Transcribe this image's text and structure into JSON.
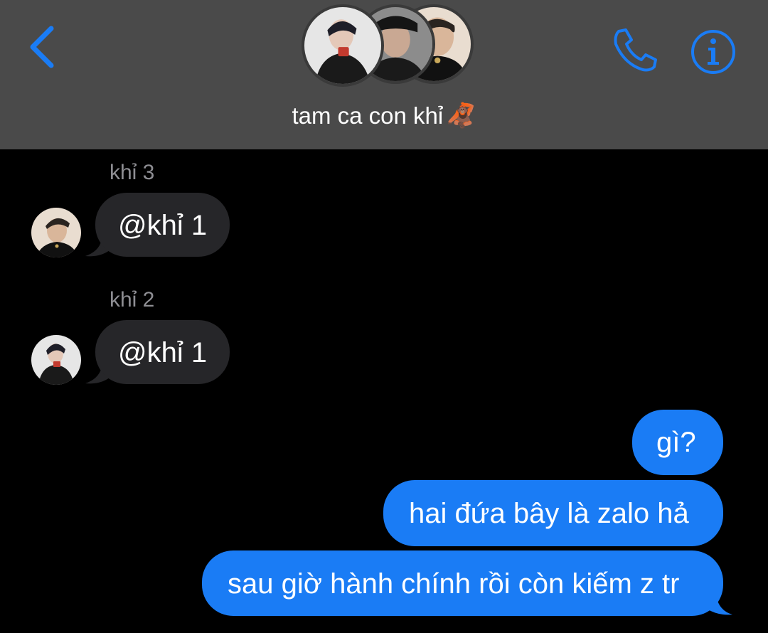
{
  "header": {
    "group_name": "tam ca con khỉ",
    "group_emoji": "🦧",
    "back_icon": "chevron-left-icon",
    "call_icon": "phone-icon",
    "info_icon": "info-icon",
    "accent_color": "#1a7cf5"
  },
  "messages": [
    {
      "direction": "incoming",
      "sender": "khỉ 3",
      "text": "@khỉ 1"
    },
    {
      "direction": "incoming",
      "sender": "khỉ 2",
      "text": "@khỉ 1"
    },
    {
      "direction": "outgoing",
      "text": "gì?"
    },
    {
      "direction": "outgoing",
      "text": "hai đứa bây là zalo hả"
    },
    {
      "direction": "outgoing",
      "text": "sau giờ hành chính rồi còn kiếm z tr"
    }
  ],
  "colors": {
    "header_bg": "#4a4a4a",
    "incoming_bubble": "#262629",
    "outgoing_bubble": "#1a7cf5",
    "sender_label": "#8e8e93"
  }
}
